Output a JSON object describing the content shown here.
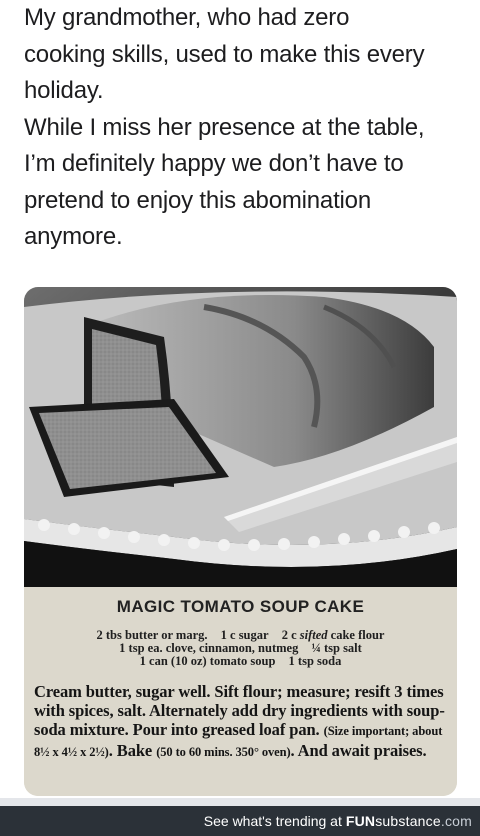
{
  "post": {
    "lines": [
      "My grandmother, who had zero",
      "cooking skills, used to make this every",
      "holiday.",
      "While I miss her presence at the table,",
      "I’m definitely happy we don’t have to",
      "pretend to enjoy this abomination",
      "anymore."
    ]
  },
  "recipe": {
    "title": "MAGIC TOMATO SOUP CAKE",
    "ingredients": {
      "row1": [
        "2 tbs butter or marg.",
        "1 c sugar",
        "2 c ",
        "sifted",
        " cake flour"
      ],
      "row2": [
        "1 tsp ea. clove, cinnamon, nutmeg",
        "¼ tsp salt"
      ],
      "row3": [
        "1 can (10 oz) tomato soup",
        "1 tsp soda"
      ]
    },
    "instructions": {
      "main": "Cream butter, sugar well. Sift flour; measure; resift 3 times with spices, salt. Alternately add dry ingredients with soup-soda mixture. Pour into greased loaf pan. ",
      "size_note": "(Size important; about 8½ x 4½ x 2½)",
      "bake": ". Bake ",
      "bake_note": "(50 to 60 mins. 350° oven)",
      "ending": ". And await praises."
    }
  },
  "footer": {
    "trend_text": "See what's trending at",
    "logo_fun": "FUN",
    "logo_sub": "substance",
    "logo_com": ".com"
  },
  "colors": {
    "footer_bg": "#2b3138",
    "recipe_bg": "#dcd8cc"
  }
}
